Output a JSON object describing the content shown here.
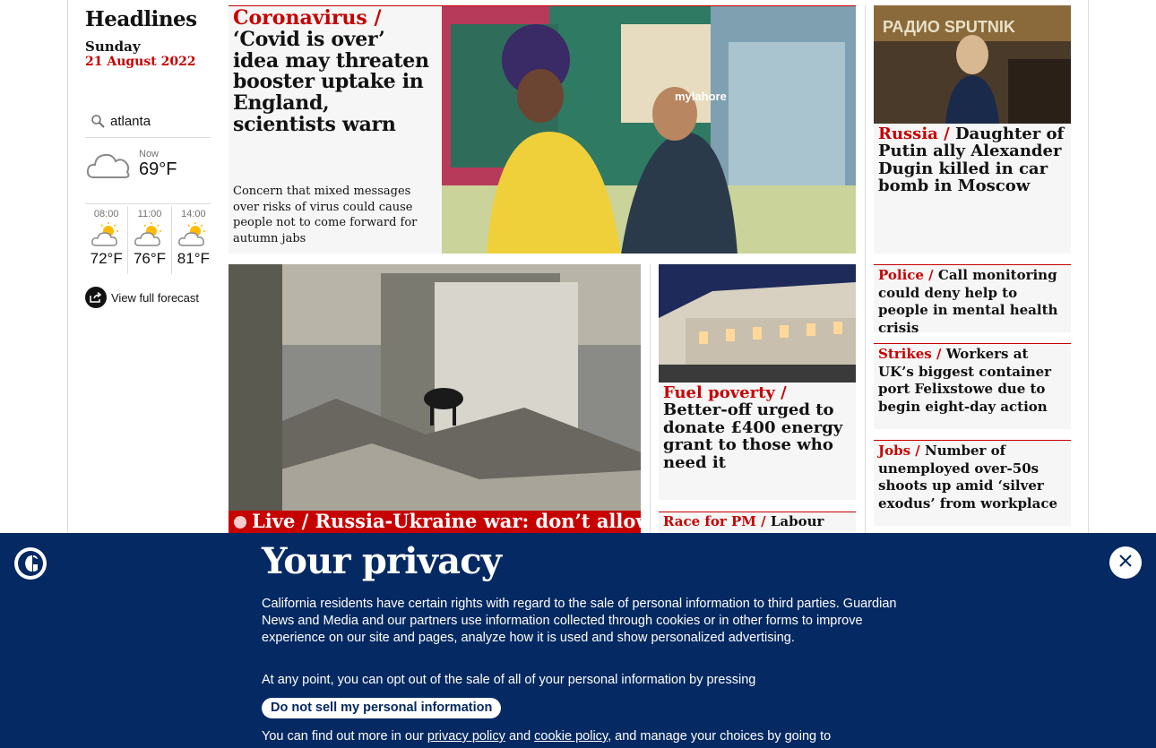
{
  "headlines": {
    "title": "Headlines",
    "day": "Sunday",
    "date": "21 August 2022"
  },
  "weather": {
    "location": "atlanta",
    "now_label": "Now",
    "now_temp": "69°F",
    "hours": [
      {
        "time": "08:00",
        "temp": "72°F",
        "icon": "sun-cloud-icon"
      },
      {
        "time": "11:00",
        "temp": "76°F",
        "icon": "sun-cloud-icon"
      },
      {
        "time": "14:00",
        "temp": "81°F",
        "icon": "sun-cloud-icon"
      }
    ],
    "forecast_link": "View full forecast"
  },
  "stories": {
    "main": {
      "kicker": "Coronavirus /",
      "headline": "‘Covid is over’ idea may threaten booster uptake in England, scientists warn",
      "standfirst": "Concern that mixed messages over risks of virus could cause people not to come forward for autumn jabs"
    },
    "russia": {
      "kicker": "Russia /",
      "headline": "Daughter of Putin ally Alexander Dugin killed in car bomb in Moscow"
    },
    "live": {
      "kicker": "Live /",
      "headline": "Russia-Ukraine war: don’t allow"
    },
    "fuel": {
      "kicker": "Fuel poverty /",
      "headline": "Better-off urged to donate £400 energy grant to those who need it"
    },
    "pm": {
      "kicker": "Race for PM /",
      "headline": "Labour"
    },
    "police": {
      "kicker": "Police /",
      "headline": "Call monitoring could deny help to people in mental health crisis"
    },
    "strikes": {
      "kicker": "Strikes /",
      "headline": "Workers at UK’s biggest container port Felixstowe due to begin eight-day action"
    },
    "jobs": {
      "kicker": "Jobs /",
      "headline": "Number of unemployed over-50s shoots up amid ‘silver exodus’ from workplace"
    }
  },
  "privacy": {
    "title": "Your privacy",
    "p1": "California residents have certain rights with regard to the sale of personal information to third parties. Guardian News and Media and our partners use information collected through cookies or in other forms to improve experience on our site and pages, analyze how it is used and show personalized advertising.",
    "p2": "At any point, you can opt out of the sale of all of your personal information by pressing",
    "button": "Do not sell my personal information",
    "p3_start": "You can find out more in our",
    "privacy_link": "privacy policy",
    "and": "and",
    "cookie_link": "cookie policy",
    "p3_end": ", and manage your choices by going to"
  },
  "colors": {
    "accent": "#c70000",
    "overlay": "#052962"
  }
}
